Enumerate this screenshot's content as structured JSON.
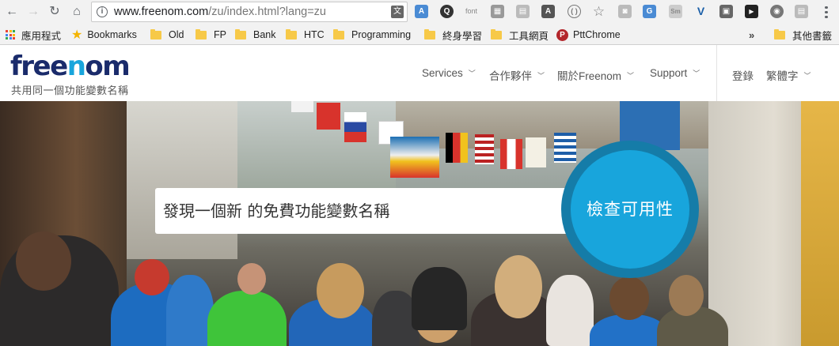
{
  "browser": {
    "url_host": "www.freenom.com",
    "url_path": "/zu/index.html?lang=zu",
    "extensions": [
      "translate-extension",
      "evernote-icon",
      "font-icon",
      "qr-icon",
      "note-icon",
      "a-icon",
      "sync-icon",
      "star-icon",
      "camera-icon",
      "google-translate-icon",
      "smart-icon",
      "v-icon",
      "tile-icon",
      "youtube-icon",
      "globe-icon"
    ]
  },
  "bookmarks": {
    "apps": "應用程式",
    "items": [
      "Bookmarks",
      "Old",
      "FP",
      "Bank",
      "HTC",
      "Programming",
      "終身學習",
      "工具網頁",
      "PttChrome"
    ],
    "other": "其他書籤"
  },
  "header": {
    "logo_parts": [
      "free",
      "n",
      "om"
    ],
    "tagline": "共用同一個功能變數名稱",
    "nav": [
      "Services",
      "合作夥伴",
      "關於Freenom",
      "Support"
    ],
    "login": "登錄",
    "language": "繁體字"
  },
  "hero": {
    "search_placeholder": "發現一個新 的免費功能變數名稱",
    "check_button": "檢查可用性",
    "brand_color": "#18a5dc",
    "ring_color": "#157ca8"
  }
}
